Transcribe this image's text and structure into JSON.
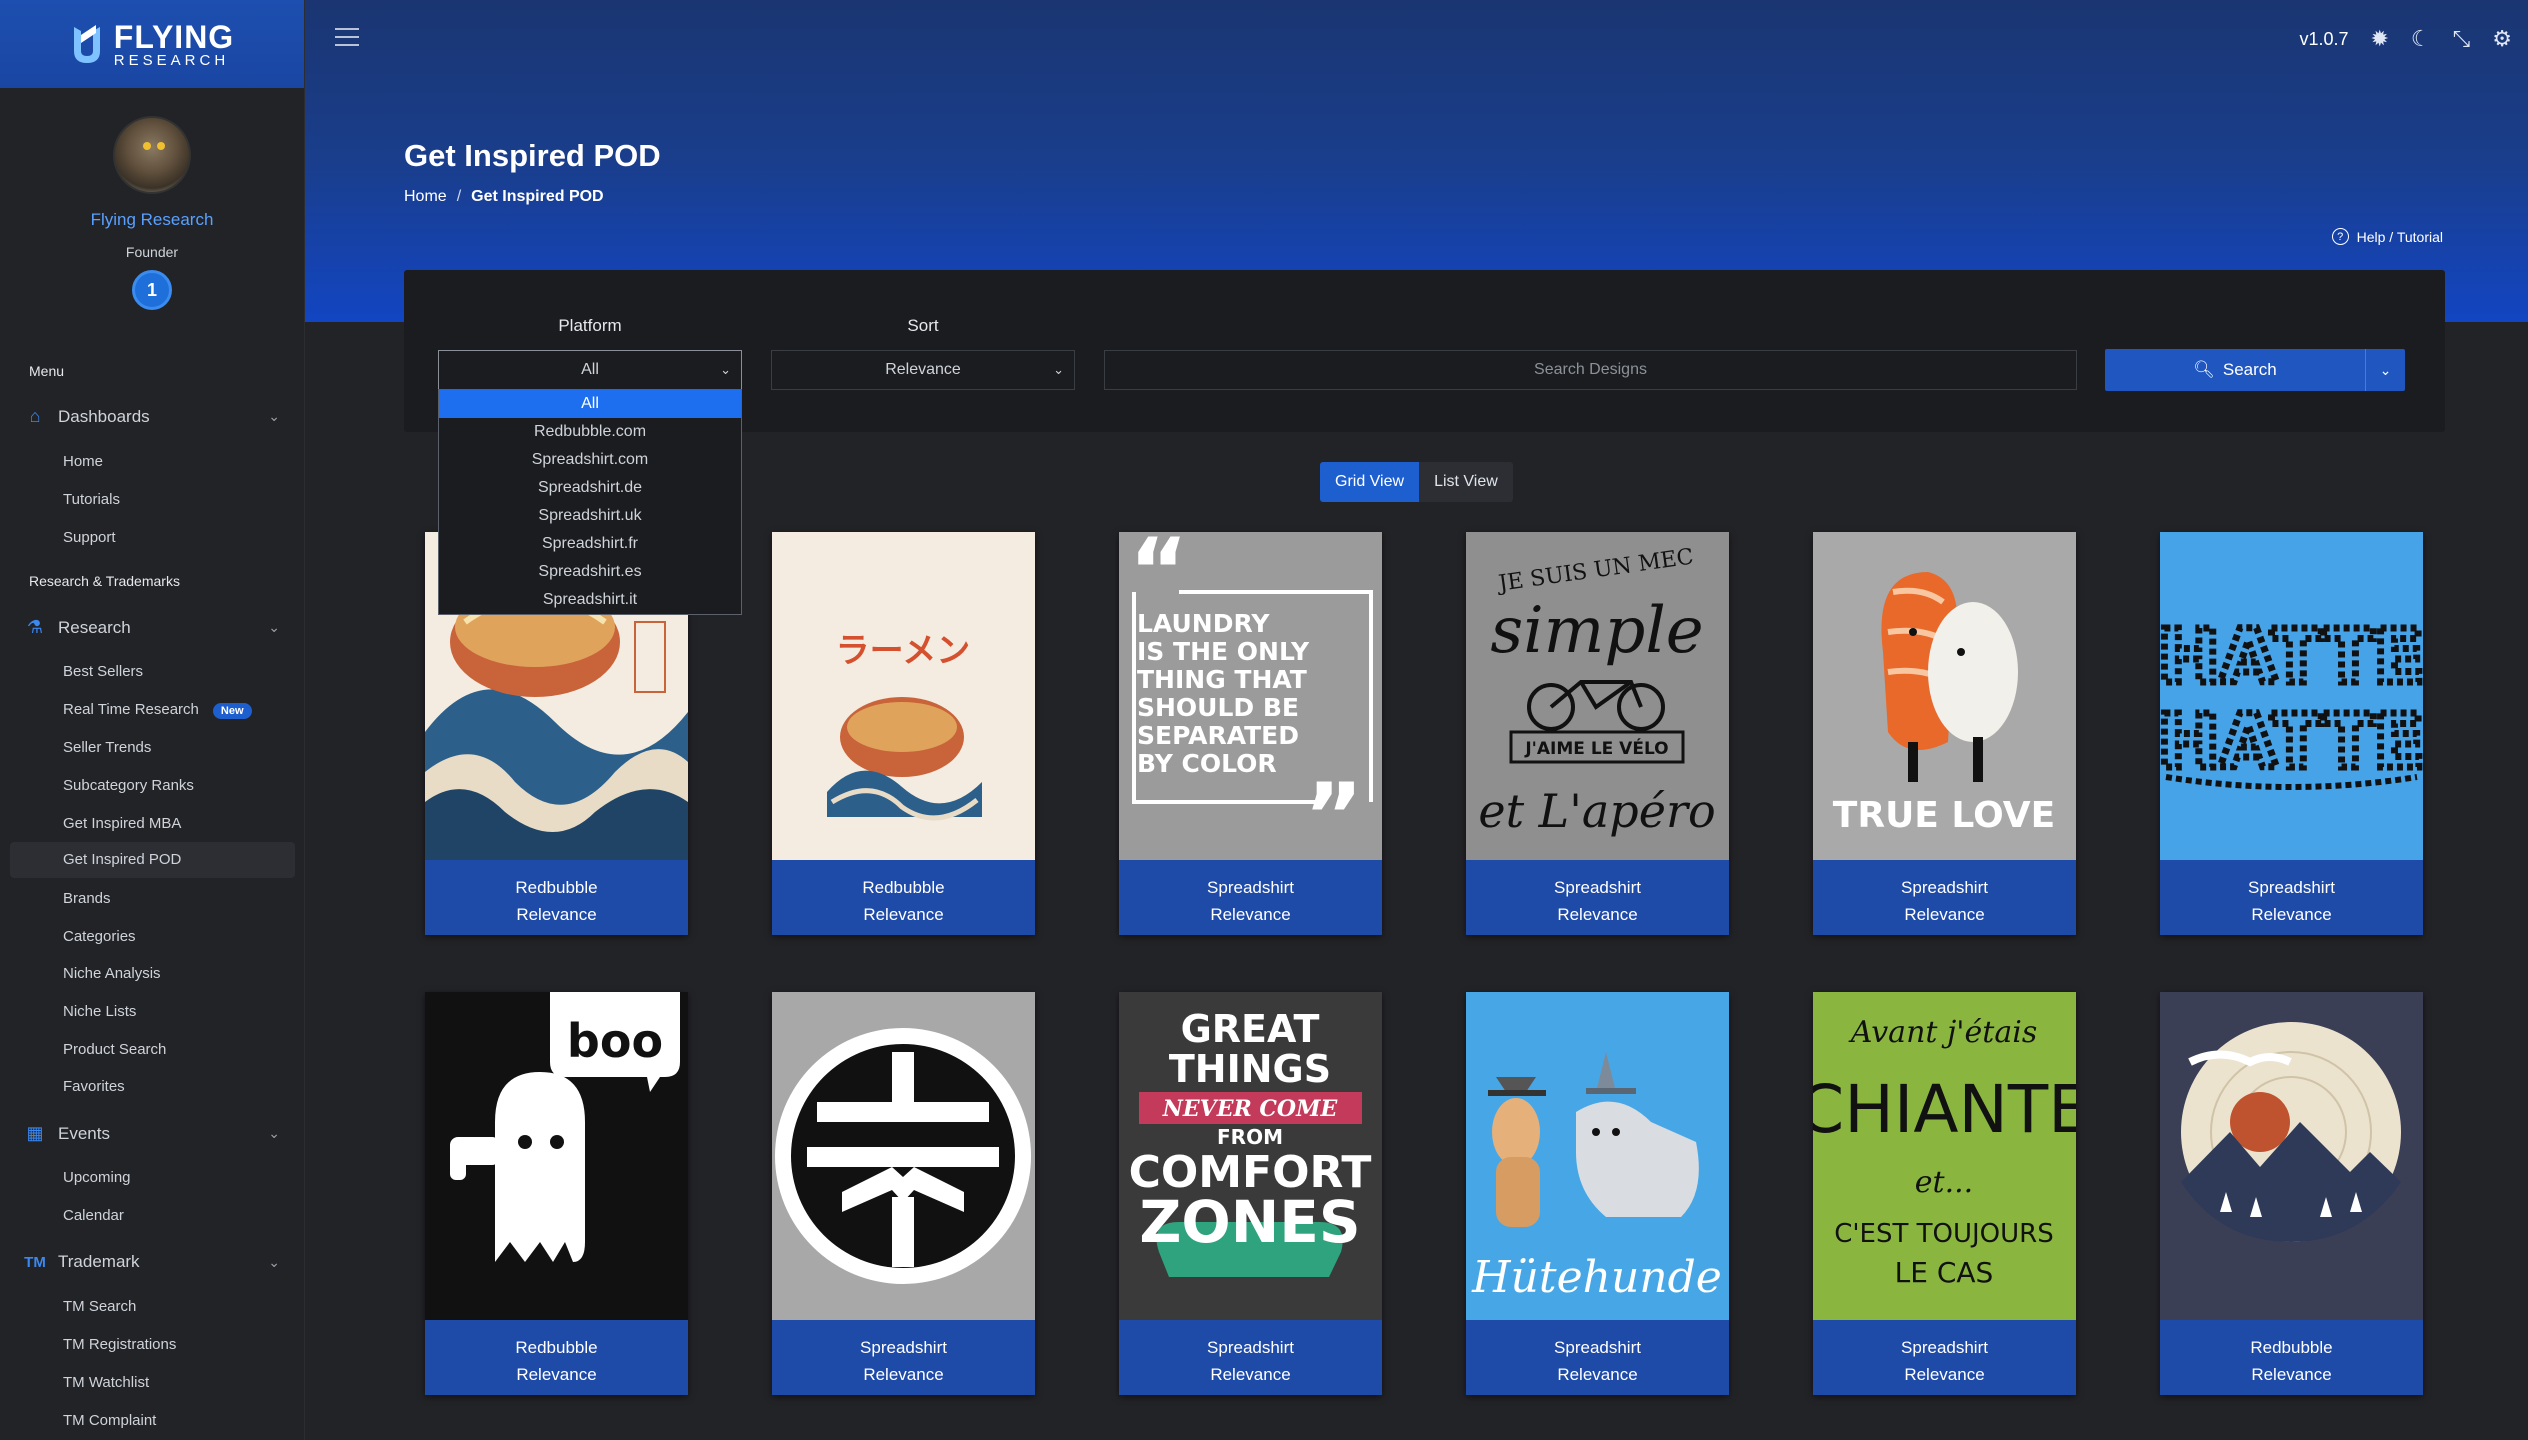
{
  "brand": {
    "line1": "FLYING",
    "line2": "RESEARCH"
  },
  "profile": {
    "name": "Flying Research",
    "role": "Founder",
    "level": "1"
  },
  "sidebar": {
    "menu_heading": "Menu",
    "research_heading": "Research & Trademarks",
    "dashboards": {
      "label": "Dashboards",
      "items": [
        "Home",
        "Tutorials",
        "Support"
      ]
    },
    "research": {
      "label": "Research",
      "items": [
        "Best Sellers",
        "Real Time Research",
        "Seller Trends",
        "Subcategory Ranks",
        "Get Inspired MBA",
        "Get Inspired POD",
        "Brands",
        "Categories",
        "Niche Analysis",
        "Niche Lists",
        "Product Search",
        "Favorites"
      ],
      "new_badge": "New"
    },
    "events": {
      "label": "Events",
      "items": [
        "Upcoming",
        "Calendar"
      ]
    },
    "trademark": {
      "prefix": "TM",
      "label": "Trademark",
      "items": [
        "TM Search",
        "TM Registrations",
        "TM Watchlist",
        "TM Complaint"
      ]
    }
  },
  "header": {
    "version": "v1.0.7",
    "title": "Get Inspired POD",
    "help": "Help / Tutorial"
  },
  "breadcrumb": {
    "home": "Home",
    "separator": "/",
    "current": "Get Inspired POD"
  },
  "filters": {
    "platform_label": "Platform",
    "platform_value": "All",
    "sort_label": "Sort",
    "sort_value": "Relevance",
    "search_placeholder": "Search Designs",
    "search_button": "Search",
    "platform_options": [
      "All",
      "Redbubble.com",
      "Spreadshirt.com",
      "Spreadshirt.de",
      "Spreadshirt.uk",
      "Spreadshirt.fr",
      "Spreadshirt.es",
      "Spreadshirt.it"
    ]
  },
  "view_toggle": {
    "grid": "Grid View",
    "list": "List View"
  },
  "cards": [
    {
      "platform": "Redbubble",
      "sort": "Relevance",
      "art": "ramen-wave",
      "bg": "#f4ece0"
    },
    {
      "platform": "Redbubble",
      "sort": "Relevance",
      "art": "ramen-small",
      "bg": "#f4ece0",
      "text": "ラーメン"
    },
    {
      "platform": "Spreadshirt",
      "sort": "Relevance",
      "art": "quote",
      "bg": "#9b9b9b",
      "text_lines": [
        "LAUNDRY",
        "IS THE ONLY",
        "THING THAT",
        "SHOULD BE",
        "SEPARATED",
        "BY COLOR"
      ]
    },
    {
      "platform": "Spreadshirt",
      "sort": "Relevance",
      "art": "velo",
      "bg": "#8f8f8f",
      "text_lines": [
        "JE SUIS UN MEC",
        "simple",
        "J'AIME LE VÉLO",
        "et L'apéro"
      ]
    },
    {
      "platform": "Spreadshirt",
      "sort": "Relevance",
      "art": "sushi",
      "bg": "#a9a9a9",
      "text": "TRUE LOVE"
    },
    {
      "platform": "Spreadshirt",
      "sort": "Relevance",
      "art": "hatte",
      "bg": "#46a3e8",
      "text_lines": [
        "HATTE",
        "HATTE"
      ]
    },
    {
      "platform": "Redbubble",
      "sort": "Relevance",
      "art": "ghost",
      "bg": "#111111",
      "text": "boo"
    },
    {
      "platform": "Spreadshirt",
      "sort": "Relevance",
      "art": "kanji",
      "bg": "#a8a8a8"
    },
    {
      "platform": "Spreadshirt",
      "sort": "Relevance",
      "art": "comfort",
      "bg": "#3a3a3a",
      "text_lines": [
        "GREAT",
        "THINGS",
        "NEVER COME",
        "FROM",
        "COMFORT",
        "ZONES"
      ]
    },
    {
      "platform": "Spreadshirt",
      "sort": "Relevance",
      "art": "dogs",
      "bg": "#47a7e6",
      "text": "Hütehunde"
    },
    {
      "platform": "Spreadshirt",
      "sort": "Relevance",
      "art": "chiante",
      "bg": "#8ab640",
      "text_lines": [
        "Avant j'étais",
        "CHIANTE",
        "et...",
        "C'EST TOUJOURS",
        "LE CAS"
      ]
    },
    {
      "platform": "Redbubble",
      "sort": "Relevance",
      "art": "moon",
      "bg": "#3a3f55"
    }
  ]
}
